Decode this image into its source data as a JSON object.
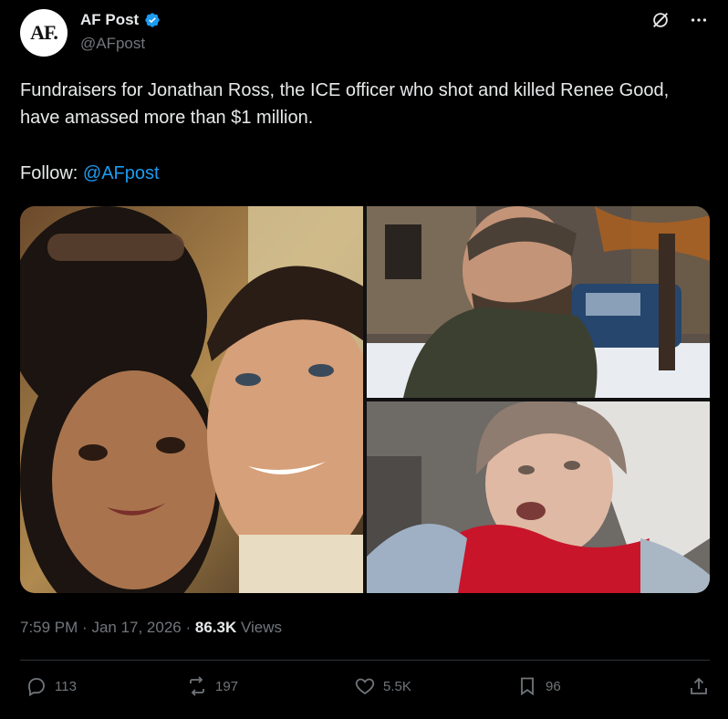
{
  "account": {
    "avatar_text": "AF.",
    "display_name": "AF Post",
    "handle": "@AFpost"
  },
  "tweet": {
    "text": "Fundraisers for Jonathan Ross, the ICE officer who shot and killed Renee Good, have amassed more than $1 million.",
    "follow_label": "Follow: ",
    "follow_link": "@AFpost",
    "time": "7:59 PM",
    "date": "Jan 17, 2026",
    "views_count": "86.3K",
    "views_label": "Views"
  },
  "actions": {
    "replies": "113",
    "reposts": "197",
    "likes": "5.5K",
    "bookmarks": "96"
  },
  "colors": {
    "background": "#000000",
    "text": "#e7e9ea",
    "muted": "#71767b",
    "link": "#1d9bf0",
    "divider": "#2f3336"
  },
  "icons": [
    "verified-badge-icon",
    "grok-icon",
    "more-icon",
    "reply-icon",
    "repost-icon",
    "like-icon",
    "bookmark-icon",
    "share-icon"
  ]
}
